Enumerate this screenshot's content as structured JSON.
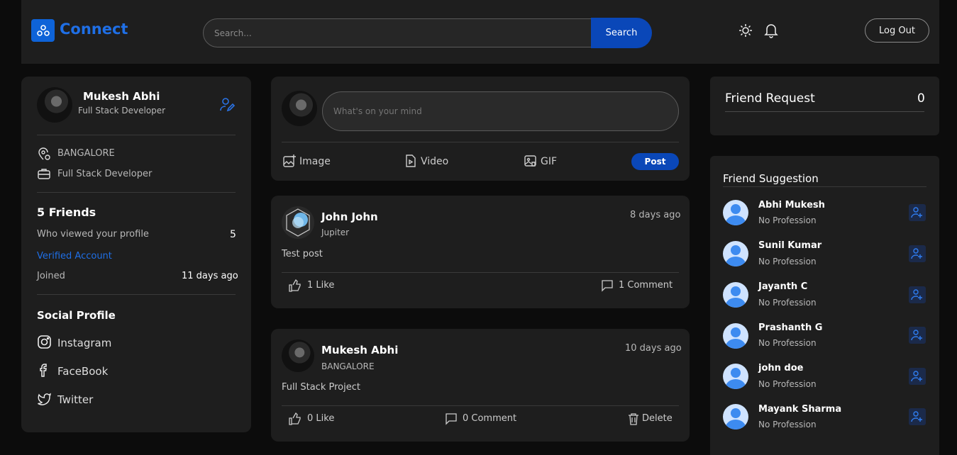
{
  "header": {
    "brand": "Connect",
    "search_placeholder": "Search...",
    "search_button": "Search",
    "logout": "Log Out"
  },
  "profile": {
    "name": "Mukesh Abhi",
    "title": "Full Stack Developer",
    "location": "BANGALORE",
    "occupation": "Full Stack Developer",
    "friends": "5 Friends",
    "viewed_label": "Who viewed your profile",
    "viewed_count": "5",
    "verified": "Verified Account",
    "joined_label": "Joined",
    "joined_value": "11 days ago",
    "social_heading": "Social Profile",
    "social": [
      "Instagram",
      "FaceBook",
      "Twitter"
    ]
  },
  "composer": {
    "placeholder": "What's on your mind",
    "image": "Image",
    "video": "Video",
    "gif": "GIF",
    "post": "Post"
  },
  "posts": [
    {
      "author": "John John",
      "subtitle": "Jupiter",
      "time": "8 days ago",
      "text": "Test post",
      "likes": "1 Like",
      "comments": "1 Comment"
    },
    {
      "author": "Mukesh Abhi",
      "subtitle": "BANGALORE",
      "time": "10 days ago",
      "text": "Full Stack Project",
      "likes": "0 Like",
      "comments": "0 Comment",
      "delete": "Delete"
    }
  ],
  "friend_request": {
    "title": "Friend Request",
    "count": "0"
  },
  "suggestions": {
    "title": "Friend Suggestion",
    "items": [
      {
        "name": "Abhi Mukesh",
        "profession": "No Profession"
      },
      {
        "name": "Sunil Kumar",
        "profession": "No Profession"
      },
      {
        "name": "Jayanth C",
        "profession": "No Profession"
      },
      {
        "name": "Prashanth G",
        "profession": "No Profession"
      },
      {
        "name": "john doe",
        "profession": "No Profession"
      },
      {
        "name": "Mayank Sharma",
        "profession": "No Profession"
      }
    ]
  },
  "colors": {
    "accent": "#0a47b8",
    "link": "#1f6fe6",
    "card": "#1e1e1e",
    "bg": "#0c0c0c"
  }
}
